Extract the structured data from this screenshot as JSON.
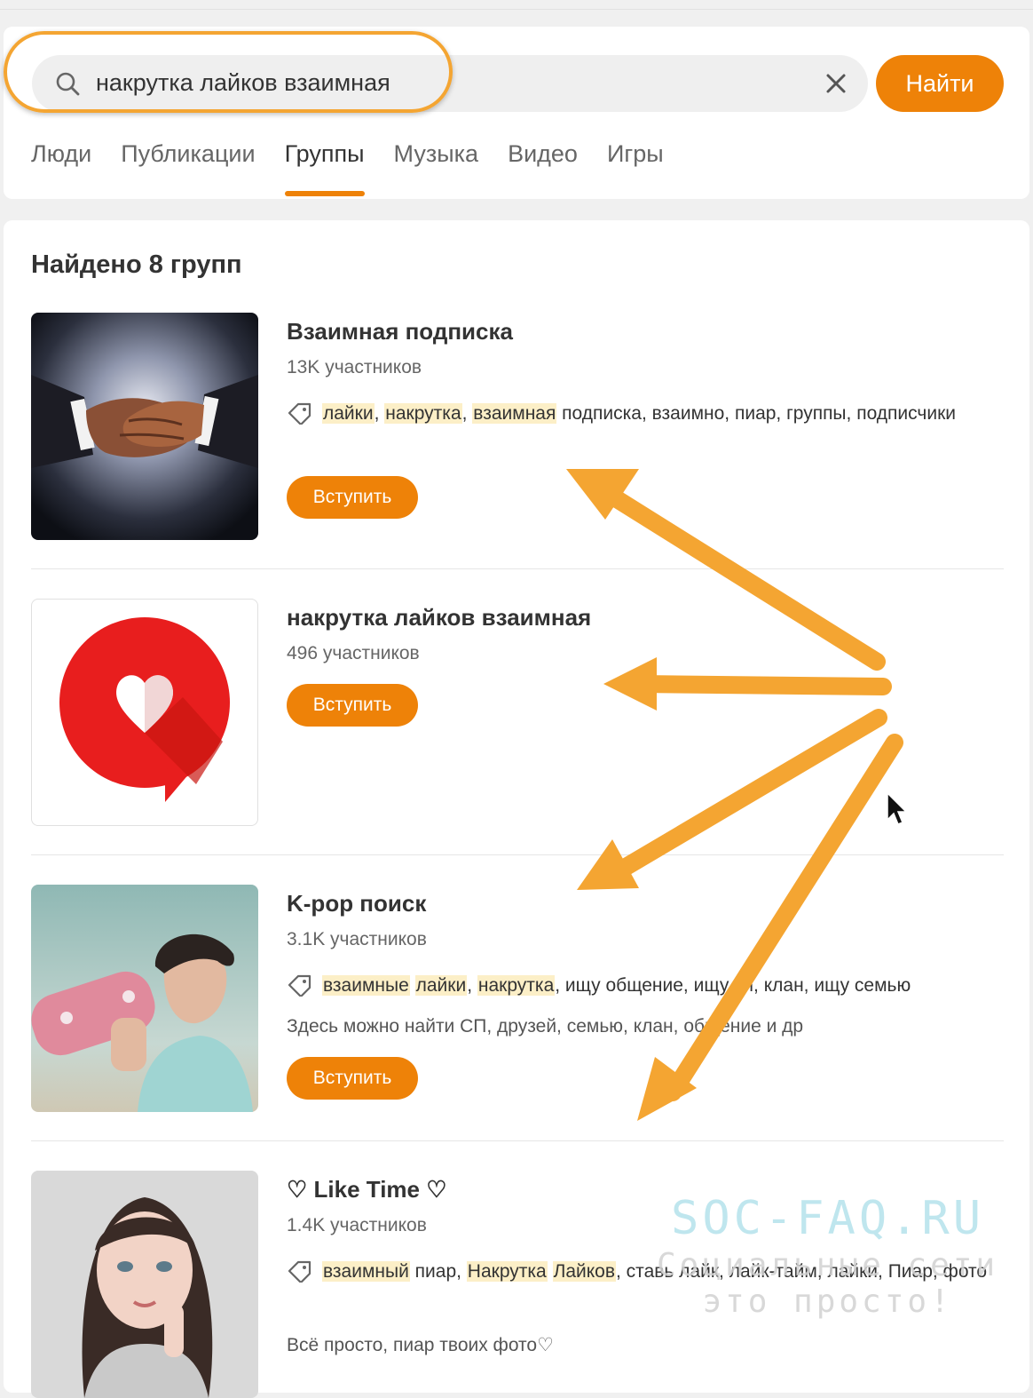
{
  "search": {
    "query": "накрутка лайков взаимная",
    "button_label": "Найти"
  },
  "tabs": [
    {
      "label": "Люди"
    },
    {
      "label": "Публикации"
    },
    {
      "label": "Группы",
      "active": true
    },
    {
      "label": "Музыка"
    },
    {
      "label": "Видео"
    },
    {
      "label": "Игры"
    }
  ],
  "results": {
    "title": "Найдено 8 групп",
    "groups": [
      {
        "name": "Взаимная подписка",
        "members": "13K участников",
        "tags": {
          "hl1": "лайки",
          "s1": ", ",
          "hl2": "накрутка",
          "s2": ", ",
          "hl3": "взаимная",
          "rest": " подписка, взаимно, пиар, группы, подписчики"
        },
        "join_label": "Вступить",
        "thumb_icon": "handshake-image"
      },
      {
        "name": "накрутка лайков взаимная",
        "members": "496 участников",
        "join_label": "Вступить",
        "thumb_icon": "heart-speech-bubble-logo"
      },
      {
        "name": "K-pop поиск",
        "members": "3.1K участников",
        "tags": {
          "hl1": "взаимные",
          "s1": " ",
          "hl2": "лайки",
          "s2": ", ",
          "hl3": "накрутка",
          "rest": ", ищу общение, ищу сп, клан, ищу семью"
        },
        "description": "Здесь можно найти СП, друзей, семью, клан, общение и др",
        "join_label": "Вступить",
        "thumb_icon": "person-with-skateboard-photo"
      },
      {
        "name": "♡ Like Time ♡",
        "members": "1.4K участников",
        "tags": {
          "hl1": "взаимный",
          "s1": " пиар, ",
          "hl2": "Накрутка",
          "s2": " ",
          "hl3": "Лайков",
          "rest": ", ставь лайк, лайк-тайм, лайки, Пиар, фото"
        },
        "description": "Всё просто, пиар твоих фото♡",
        "thumb_icon": "portrait-photo"
      }
    ]
  },
  "watermark": {
    "line1": "SOC-FAQ.RU",
    "line2": "Социальные сети",
    "line3": "это просто!"
  },
  "colors": {
    "accent": "#ee8208",
    "annotation_arrow": "#f4a532",
    "tag_highlight": "#fcefc7"
  }
}
